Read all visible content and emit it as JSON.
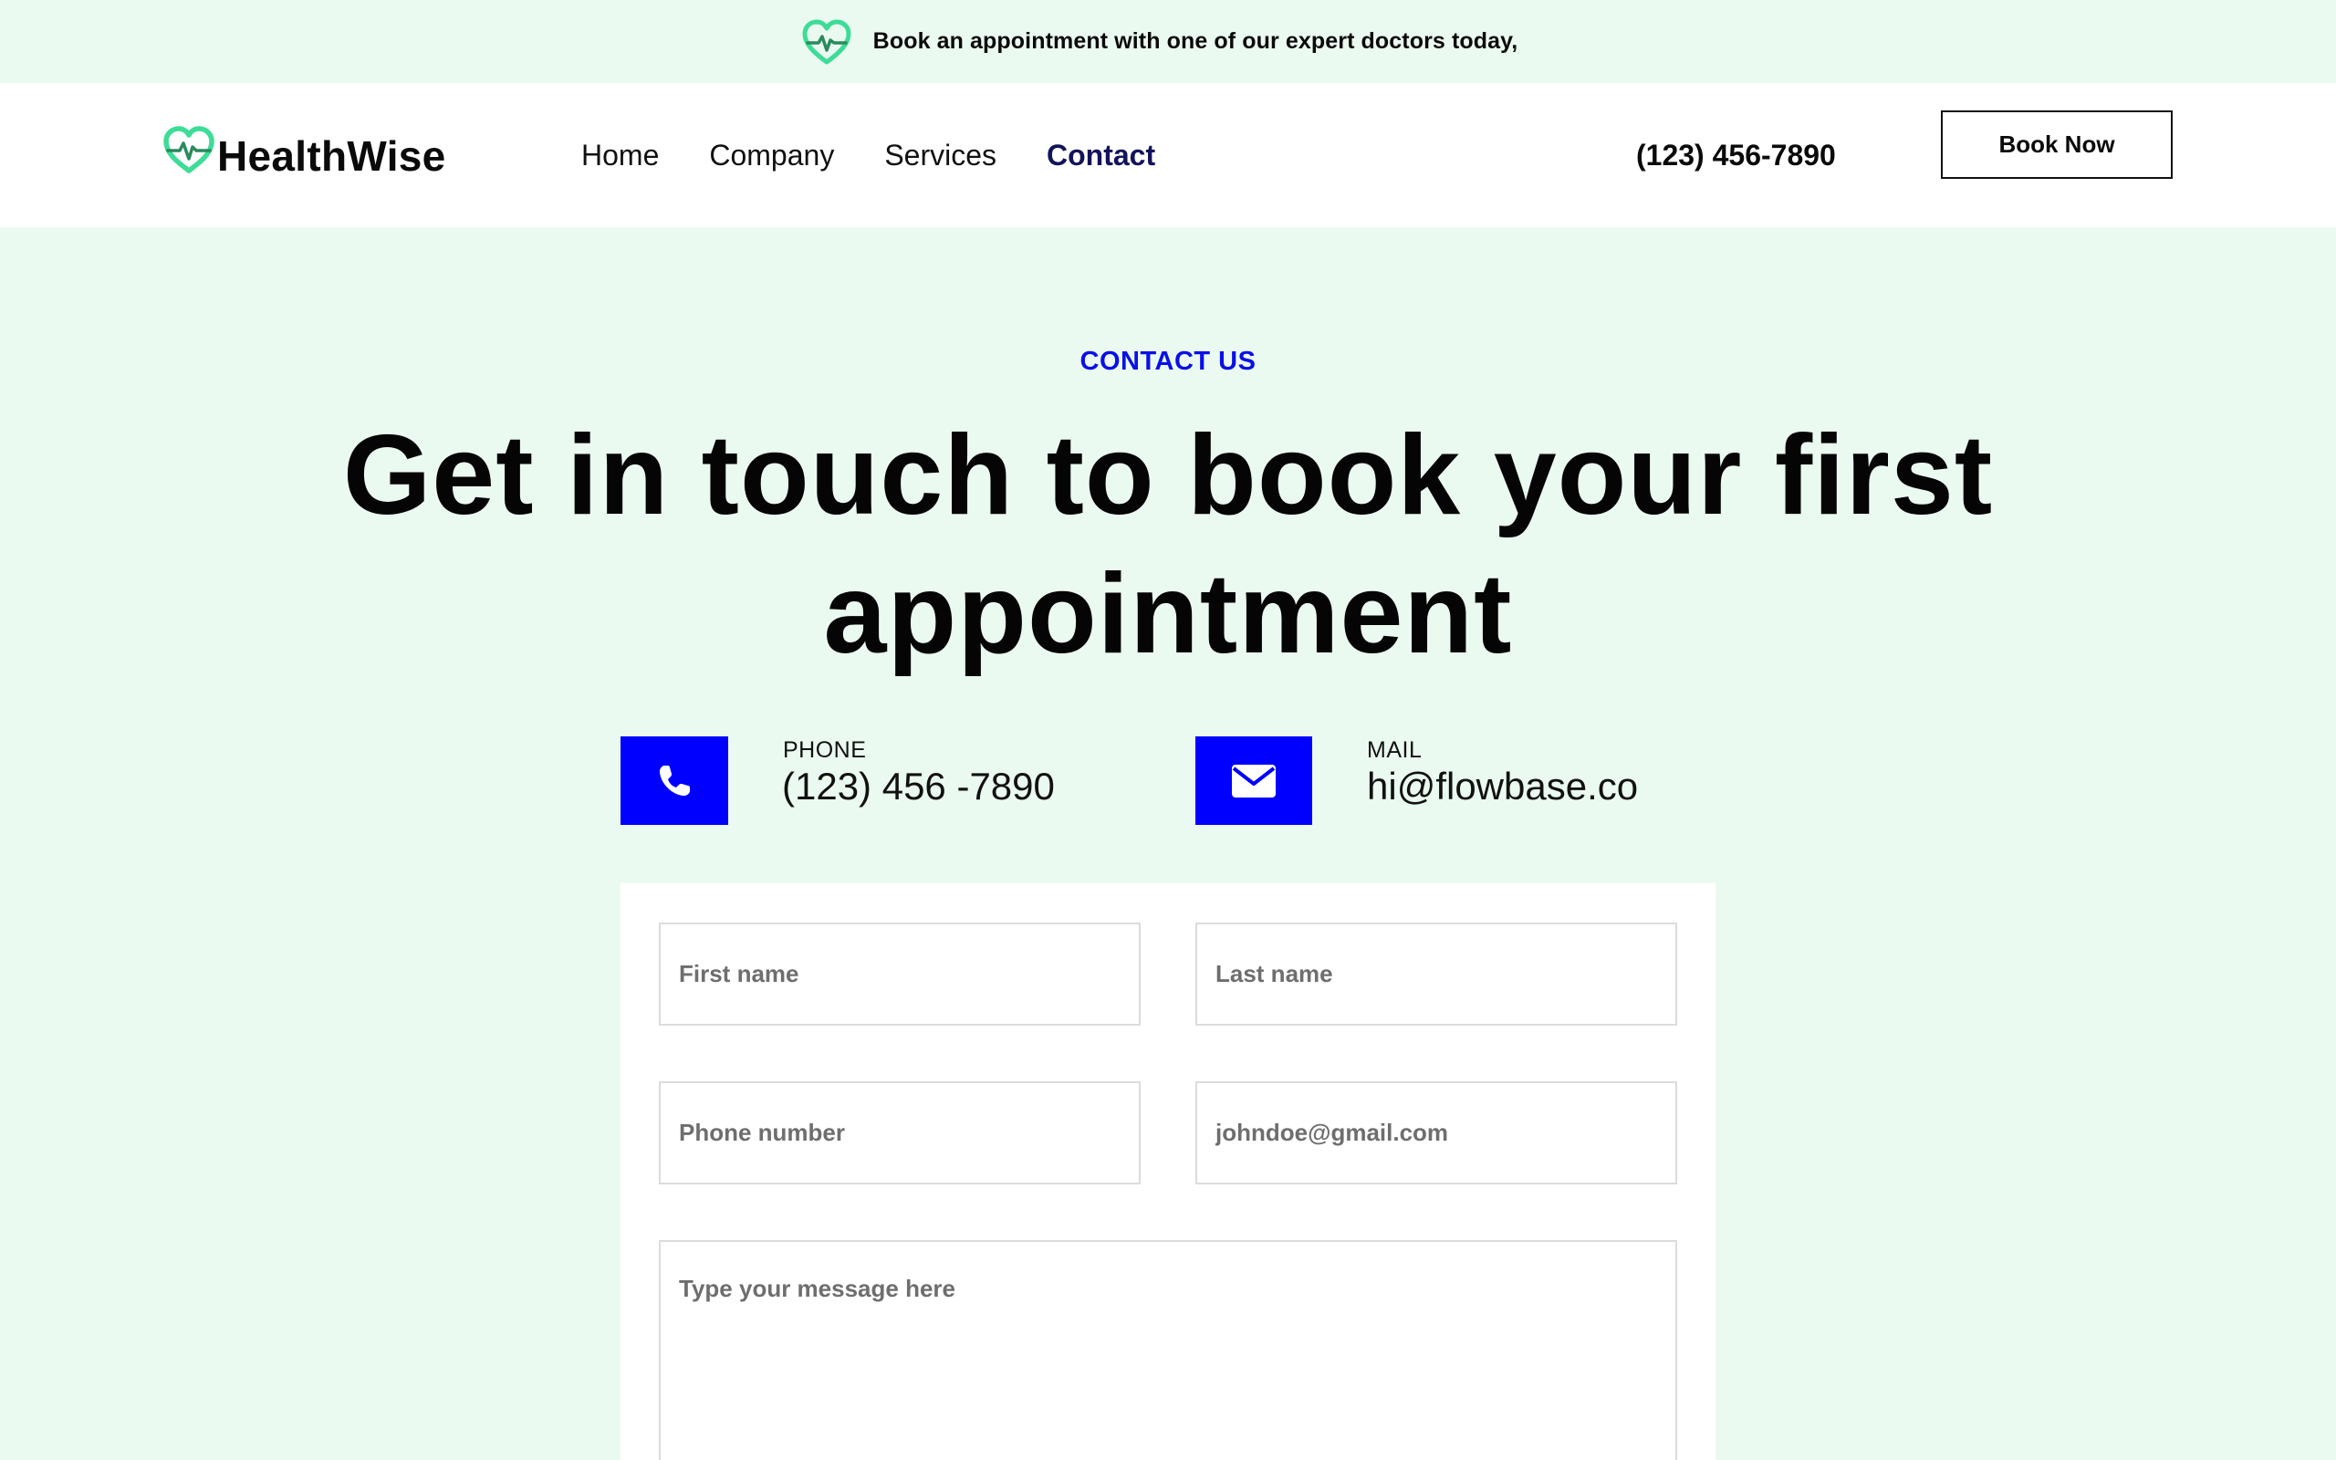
{
  "announcement": {
    "text": "Book an appointment with one of our expert doctors today,",
    "icon": "heart-pulse-icon"
  },
  "navbar": {
    "logo_text": "HealthWise",
    "logo_icon": "heart-pulse-icon",
    "links": [
      {
        "label": "Home",
        "active": false
      },
      {
        "label": "Company",
        "active": false
      },
      {
        "label": "Services",
        "active": false
      },
      {
        "label": "Contact",
        "active": true
      }
    ],
    "phone": "(123) 456-7890",
    "cta_label": "Book Now"
  },
  "hero": {
    "eyebrow": "CONTACT US",
    "headline": "Get in touch to book your first appointment"
  },
  "contact": {
    "phone": {
      "label": "PHONE",
      "value": "(123) 456 -7890",
      "icon": "phone-icon"
    },
    "mail": {
      "label": "MAIL",
      "value": "hi@flowbase.co",
      "icon": "envelope-icon"
    }
  },
  "form": {
    "first_name_placeholder": "First name",
    "last_name_placeholder": "Last name",
    "phone_placeholder": "Phone number",
    "email_placeholder": "johndoe@gmail.com",
    "message_placeholder": "Type your message here"
  },
  "colors": {
    "page_bg": "#ebfaf1",
    "accent_blue": "#0000ff",
    "eyebrow_blue": "#0a10e6",
    "active_nav": "#13135c",
    "logo_green": "#3ddc97"
  }
}
